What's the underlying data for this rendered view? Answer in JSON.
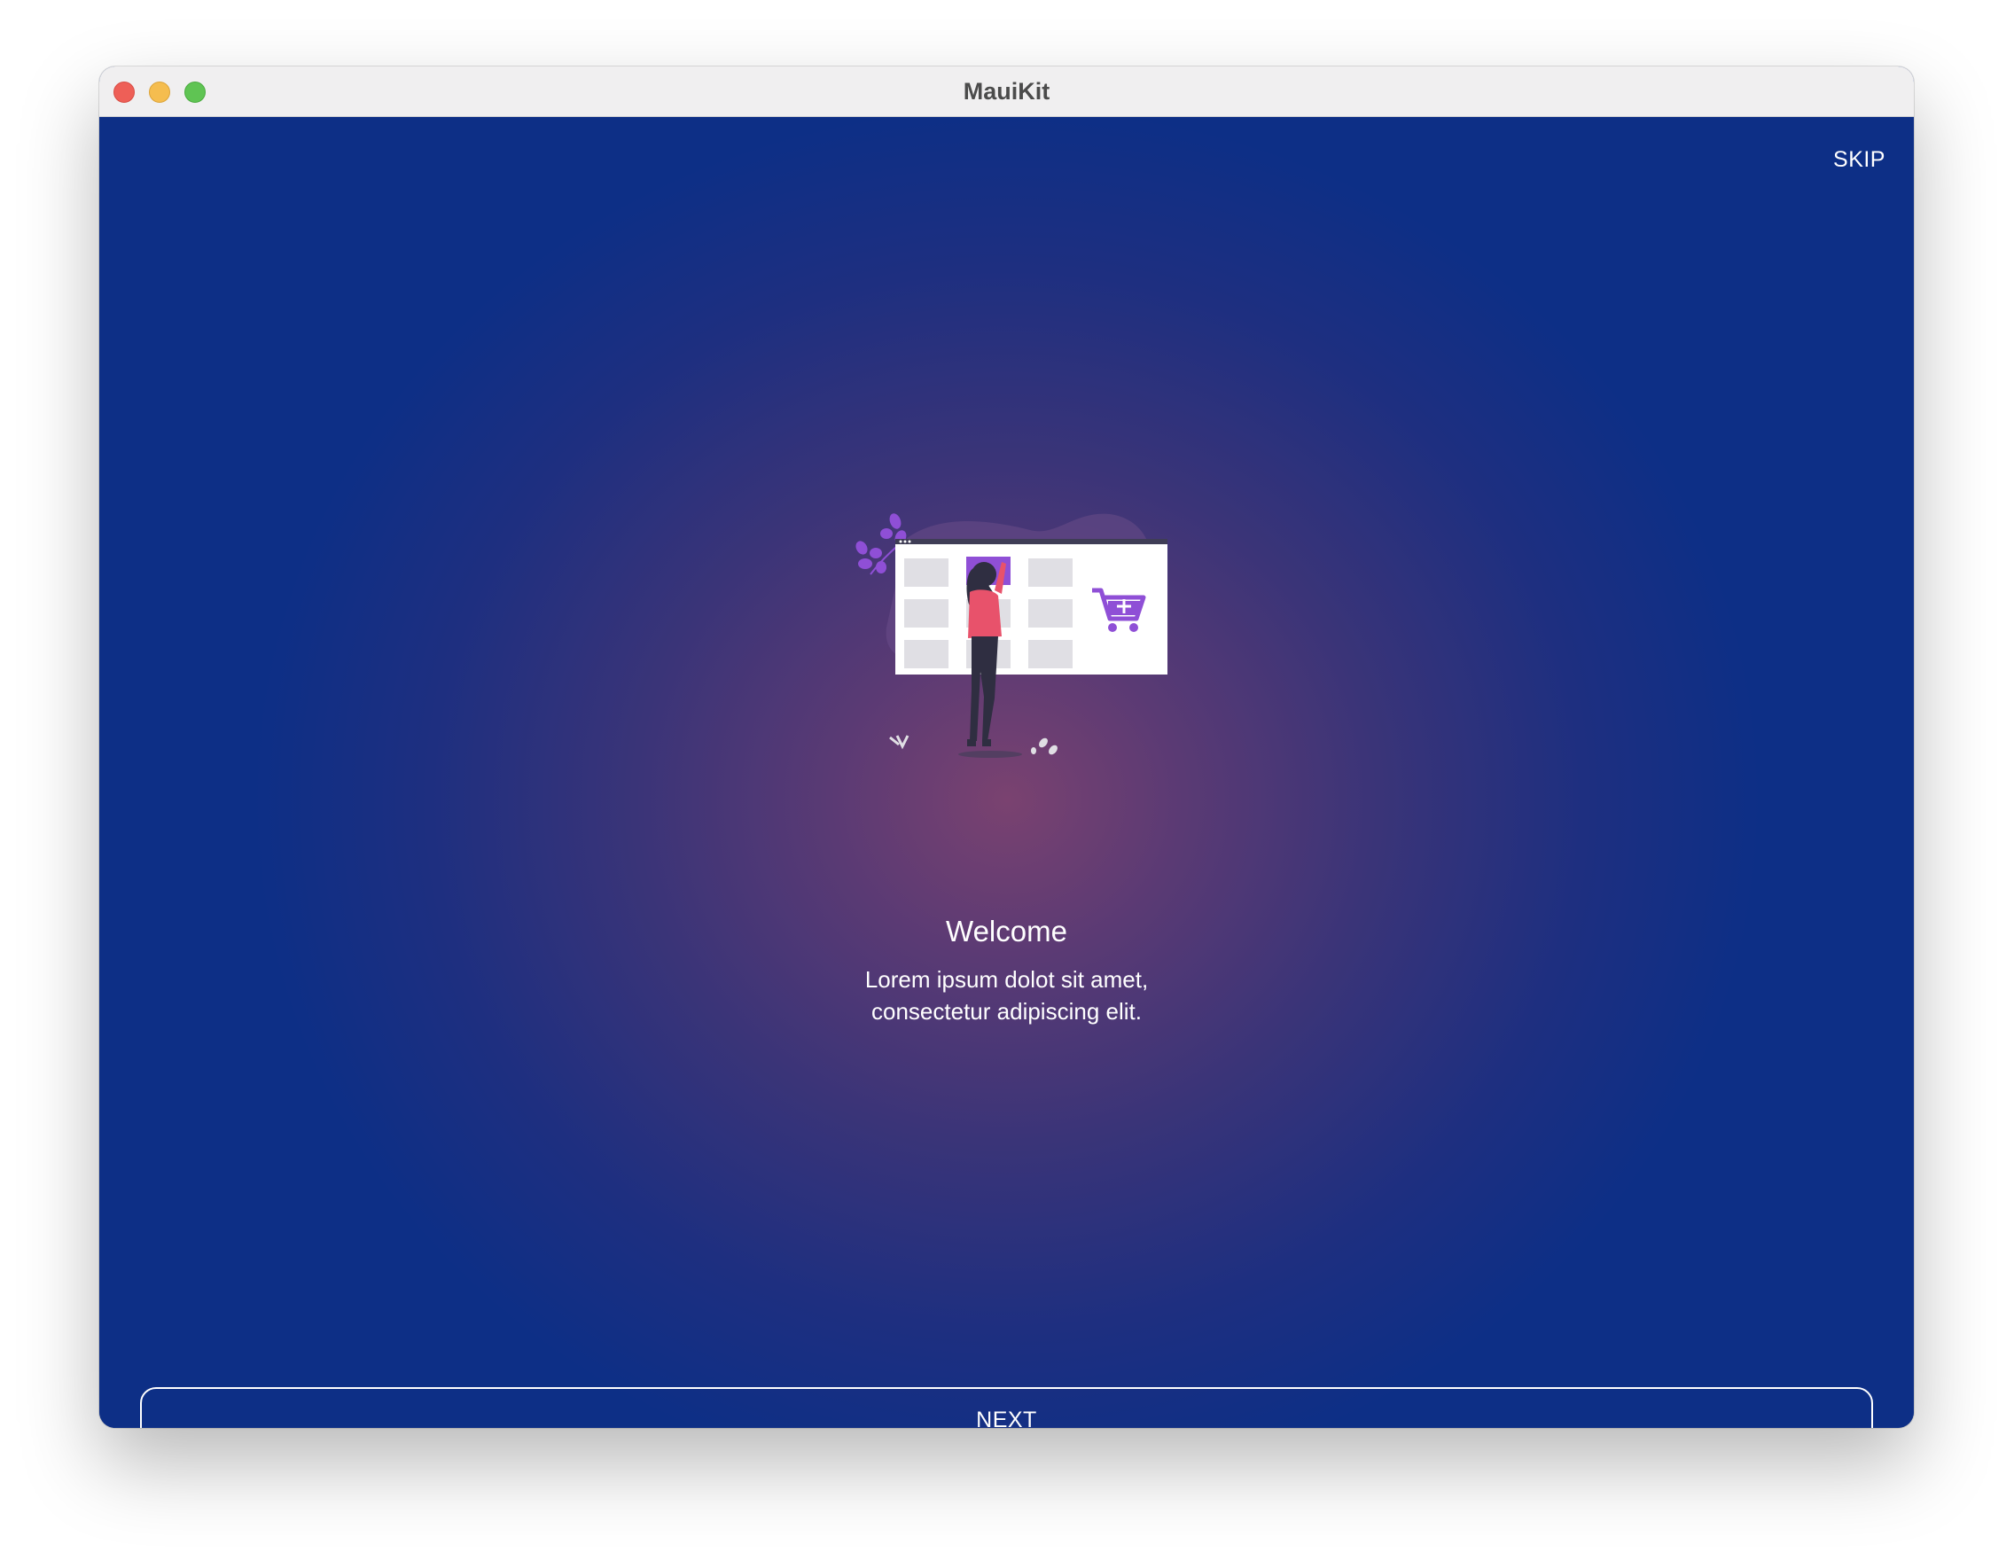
{
  "window": {
    "title": "MauiKit"
  },
  "onboarding": {
    "skip_label": "SKIP",
    "title": "Welcome",
    "body_line1": "Lorem ipsum dolot sit amet,",
    "body_line2": "consectetur adipiscing elit.",
    "next_label": "NEXT",
    "illustration": "woman-shopping-illustration"
  },
  "colors": {
    "background": "#0d2f86",
    "glow": "#7a4270",
    "accent_purple": "#8f4fd6",
    "figure_top": "#e8526b"
  }
}
